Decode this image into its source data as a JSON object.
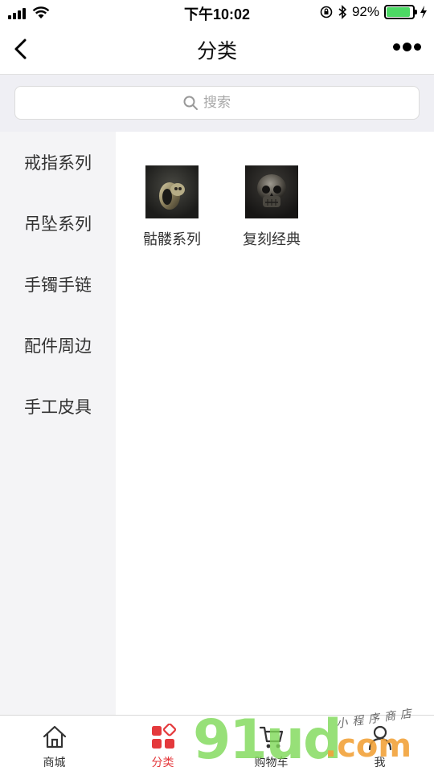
{
  "status_bar": {
    "time": "下午10:02",
    "battery_percent": "92%",
    "battery_level": 0.92,
    "battery_color": "#4cd964"
  },
  "nav": {
    "title": "分类",
    "back_icon": "chevron-left-icon",
    "more_icon": "more-dots-icon"
  },
  "search": {
    "placeholder": "搜索",
    "icon": "search-icon"
  },
  "sidebar": {
    "items": [
      {
        "label": "戒指系列"
      },
      {
        "label": "吊坠系列"
      },
      {
        "label": "手镯手链"
      },
      {
        "label": "配件周边"
      },
      {
        "label": "手工皮具"
      }
    ]
  },
  "content": {
    "categories": [
      {
        "label": "骷髅系列",
        "image": "ring-photo"
      },
      {
        "label": "复刻经典",
        "image": "skull-photo"
      }
    ]
  },
  "tab_bar": {
    "accent_color": "#e4393c",
    "tabs": [
      {
        "label": "商城",
        "icon": "home-icon",
        "active": false
      },
      {
        "label": "分类",
        "icon": "category-icon",
        "active": true
      },
      {
        "label": "购物车",
        "icon": "cart-icon",
        "active": false
      },
      {
        "label": "我",
        "icon": "user-icon",
        "active": false
      }
    ]
  },
  "watermark": {
    "main": "91ud",
    "suffix": ".com",
    "tagline": "小程序商店"
  }
}
